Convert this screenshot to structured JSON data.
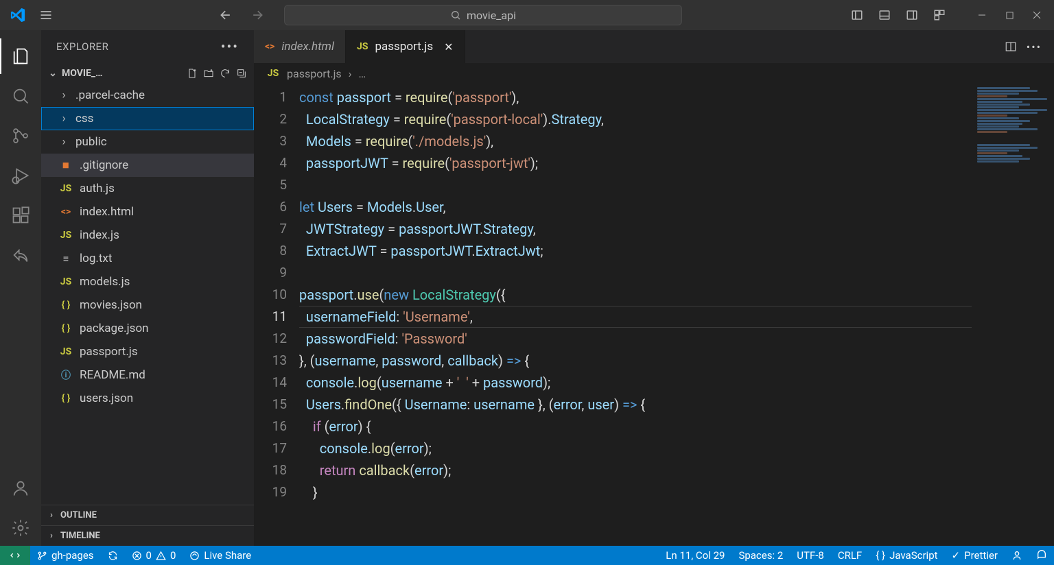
{
  "titlebar": {
    "search_text": "movie_api"
  },
  "sidebar": {
    "title": "EXPLORER",
    "folder": "MOVIE_…",
    "sections": {
      "outline": "OUTLINE",
      "timeline": "TIMELINE"
    },
    "tree": [
      {
        "kind": "folder",
        "name": ".parcel-cache"
      },
      {
        "kind": "folder",
        "name": "css",
        "selected": true
      },
      {
        "kind": "folder",
        "name": "public"
      },
      {
        "kind": "file",
        "name": ".gitignore",
        "icon": "git",
        "hover": true
      },
      {
        "kind": "file",
        "name": "auth.js",
        "icon": "js"
      },
      {
        "kind": "file",
        "name": "index.html",
        "icon": "html"
      },
      {
        "kind": "file",
        "name": "index.js",
        "icon": "js"
      },
      {
        "kind": "file",
        "name": "log.txt",
        "icon": "txt"
      },
      {
        "kind": "file",
        "name": "models.js",
        "icon": "js"
      },
      {
        "kind": "file",
        "name": "movies.json",
        "icon": "json"
      },
      {
        "kind": "file",
        "name": "package.json",
        "icon": "json"
      },
      {
        "kind": "file",
        "name": "passport.js",
        "icon": "js"
      },
      {
        "kind": "file",
        "name": "README.md",
        "icon": "md"
      },
      {
        "kind": "file",
        "name": "users.json",
        "icon": "json"
      }
    ]
  },
  "tabs": [
    {
      "label": "index.html",
      "icon": "html",
      "italic": true,
      "active": false
    },
    {
      "label": "passport.js",
      "icon": "js",
      "italic": false,
      "active": true
    }
  ],
  "breadcrumb": {
    "file": "passport.js",
    "rest": "…"
  },
  "editor": {
    "current_line": 11,
    "line_count": 19,
    "lines_html": [
      "<span class='k-blue'>const</span> <span class='k-lblue'>passport</span> <span class='k-wht'>=</span> <span class='k-yel'>require</span><span class='k-wht'>(</span><span class='k-str'>'passport'</span><span class='k-wht'>),</span>",
      "  <span class='k-lblue'>LocalStrategy</span> <span class='k-wht'>=</span> <span class='k-yel'>require</span><span class='k-wht'>(</span><span class='k-str'>'passport-local'</span><span class='k-wht'>).</span><span class='k-lblue'>Strategy</span><span class='k-wht'>,</span>",
      "  <span class='k-lblue'>Models</span> <span class='k-wht'>=</span> <span class='k-yel'>require</span><span class='k-wht'>(</span><span class='k-str'>'./models.js'</span><span class='k-wht'>),</span>",
      "  <span class='k-lblue'>passportJWT</span> <span class='k-wht'>=</span> <span class='k-yel'>require</span><span class='k-wht'>(</span><span class='k-str'>'passport-jwt'</span><span class='k-wht'>);</span>",
      "",
      "<span class='k-blue'>let</span> <span class='k-lblue'>Users</span> <span class='k-wht'>=</span> <span class='k-lblue'>Models</span><span class='k-wht'>.</span><span class='k-lblue'>User</span><span class='k-wht'>,</span>",
      "  <span class='k-lblue'>JWTStrategy</span> <span class='k-wht'>=</span> <span class='k-lblue'>passportJWT</span><span class='k-wht'>.</span><span class='k-lblue'>Strategy</span><span class='k-wht'>,</span>",
      "  <span class='k-lblue'>ExtractJWT</span> <span class='k-wht'>=</span> <span class='k-lblue'>passportJWT</span><span class='k-wht'>.</span><span class='k-lblue'>ExtractJwt</span><span class='k-wht'>;</span>",
      "",
      "<span class='k-lblue'>passport</span><span class='k-wht'>.</span><span class='k-yel'>use</span><span class='k-wht'>(</span><span class='k-blue'>new</span> <span class='k-teal'>LocalStrategy</span><span class='k-wht'>({</span>",
      "  <span class='k-lblue'>usernameField</span><span class='k-wht'>:</span> <span class='k-str'>'Username'</span><span class='k-wht'>,</span>",
      "  <span class='k-lblue'>passwordField</span><span class='k-wht'>:</span> <span class='k-str'>'Password'</span>",
      "<span class='k-wht'>}, (</span><span class='k-lblue'>username</span><span class='k-wht'>,</span> <span class='k-lblue'>password</span><span class='k-wht'>,</span> <span class='k-lblue'>callback</span><span class='k-wht'>)</span> <span class='k-blue'>=&gt;</span> <span class='k-wht'>{</span>",
      "  <span class='k-lblue'>console</span><span class='k-wht'>.</span><span class='k-yel'>log</span><span class='k-wht'>(</span><span class='k-lblue'>username</span> <span class='k-wht'>+</span> <span class='k-str'>'  '</span> <span class='k-wht'>+</span> <span class='k-lblue'>password</span><span class='k-wht'>);</span>",
      "  <span class='k-lblue'>Users</span><span class='k-wht'>.</span><span class='k-yel'>findOne</span><span class='k-wht'>({ </span><span class='k-lblue'>Username</span><span class='k-wht'>:</span> <span class='k-lblue'>username</span> <span class='k-wht'>}, (</span><span class='k-lblue'>error</span><span class='k-wht'>,</span> <span class='k-lblue'>user</span><span class='k-wht'>)</span> <span class='k-blue'>=&gt;</span> <span class='k-wht'>{</span>",
      "    <span class='k-pur'>if</span> <span class='k-wht'>(</span><span class='k-lblue'>error</span><span class='k-wht'>) {</span>",
      "      <span class='k-lblue'>console</span><span class='k-wht'>.</span><span class='k-yel'>log</span><span class='k-wht'>(</span><span class='k-lblue'>error</span><span class='k-wht'>);</span>",
      "      <span class='k-pur'>return</span> <span class='k-yel'>callback</span><span class='k-wht'>(</span><span class='k-lblue'>error</span><span class='k-wht'>);</span>",
      "    <span class='k-wht'>}</span>"
    ]
  },
  "statusbar": {
    "branch": "gh-pages",
    "errors": "0",
    "warnings": "0",
    "live_share": "Live Share",
    "cursor": "Ln 11, Col 29",
    "spaces": "Spaces: 2",
    "encoding": "UTF-8",
    "eol": "CRLF",
    "language": "JavaScript",
    "prettier": "Prettier"
  }
}
